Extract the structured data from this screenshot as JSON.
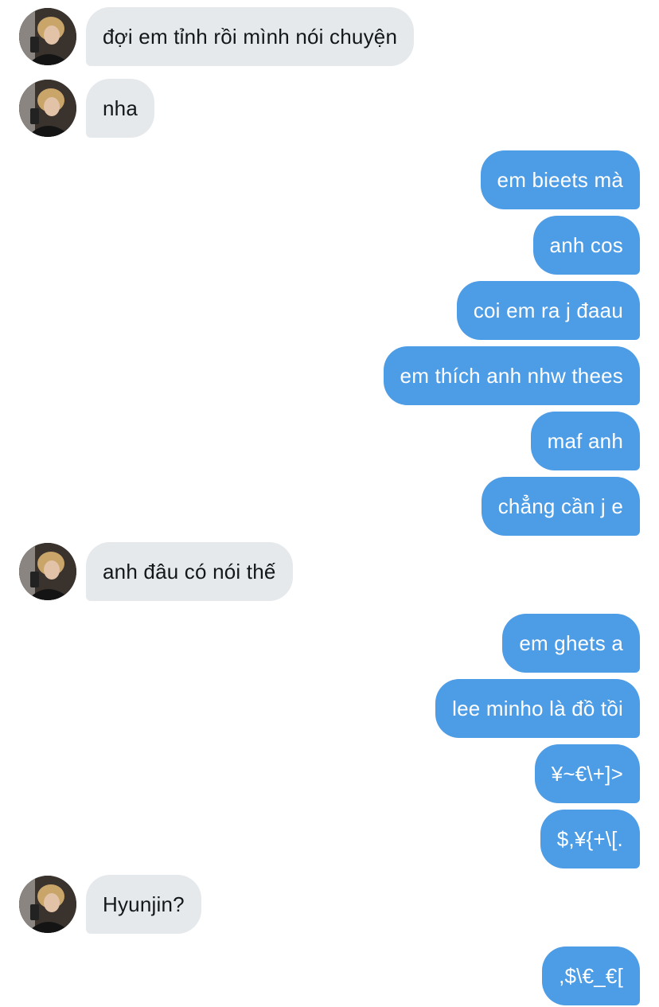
{
  "contact": {
    "avatar": "profile-photo",
    "name": ""
  },
  "messages": [
    {
      "sender": "them",
      "text": "đợi em tỉnh rồi mình nói chuyện"
    },
    {
      "sender": "them",
      "text": "nha"
    },
    {
      "sender": "me",
      "text": "em bieets mà"
    },
    {
      "sender": "me",
      "text": "anh cos"
    },
    {
      "sender": "me",
      "text": "coi em ra j đaau"
    },
    {
      "sender": "me",
      "text": "em thích anh nhw thees"
    },
    {
      "sender": "me",
      "text": "maf anh"
    },
    {
      "sender": "me",
      "text": "chẳng cần j e"
    },
    {
      "sender": "them",
      "text": "anh đâu có nói thế"
    },
    {
      "sender": "me",
      "text": "em ghets a"
    },
    {
      "sender": "me",
      "text": "lee minho là đồ tồi"
    },
    {
      "sender": "me",
      "text": "¥~€\\+]>"
    },
    {
      "sender": "me",
      "text": "$,¥{+\\[."
    },
    {
      "sender": "them",
      "text": "Hyunjin?"
    },
    {
      "sender": "me",
      "text": ",$\\€_€["
    }
  ],
  "colors": {
    "incoming_bubble": "#e6e9ec",
    "incoming_text": "#14171a",
    "outgoing_bubble": "#4d9ce6",
    "outgoing_text": "#ffffff",
    "background": "#ffffff"
  }
}
